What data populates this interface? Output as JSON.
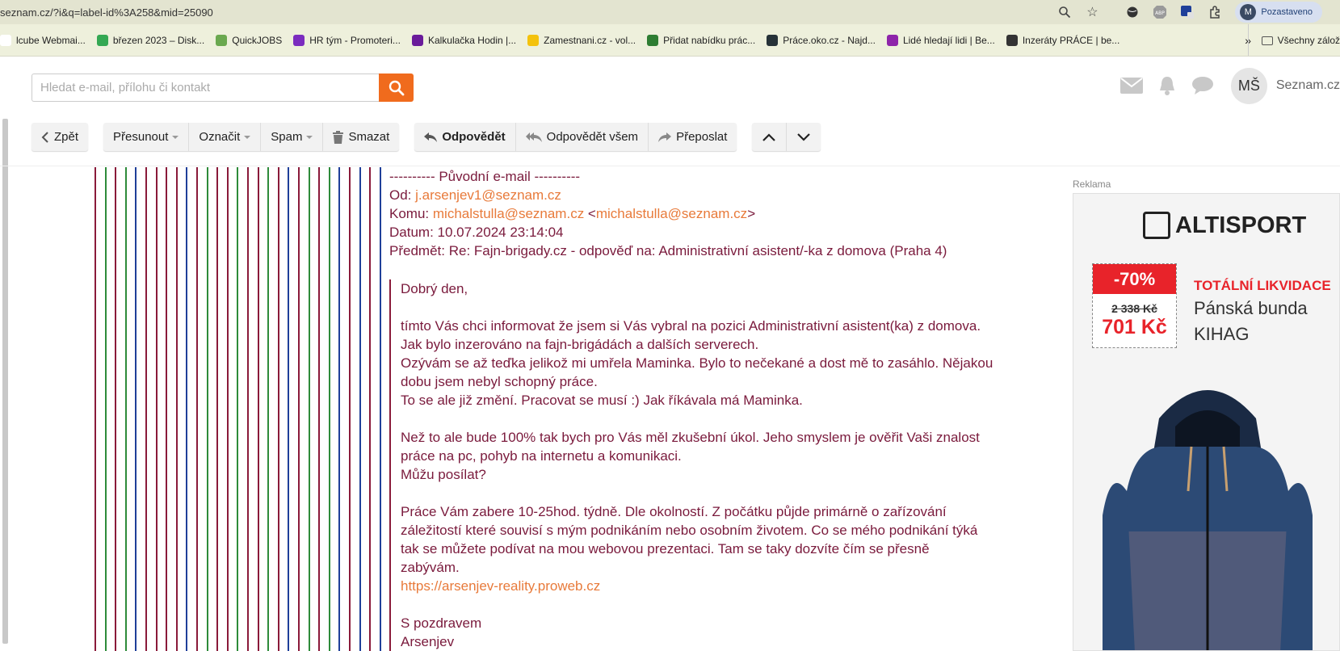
{
  "browser": {
    "url": "seznam.cz/?i&q=label-id%3A258&mid=25090",
    "profile_initial": "M",
    "profile_status": "Pozastaveno",
    "bookmarks": [
      {
        "label": "lcube Webmai...",
        "color": "#ffffff"
      },
      {
        "label": "březen 2023 – Disk...",
        "color": "#34a853"
      },
      {
        "label": "QuickJOBS",
        "color": "#6aa84f"
      },
      {
        "label": "HR tým - Promoteri...",
        "color": "#7b2cbf"
      },
      {
        "label": "Kalkulačka Hodin |...",
        "color": "#6a1b9a"
      },
      {
        "label": "Zamestnani.cz - vol...",
        "color": "#f4c20d"
      },
      {
        "label": "Přidat nabídku prác...",
        "color": "#2e7d32"
      },
      {
        "label": "Práce.oko.cz - Najd...",
        "color": "#263238"
      },
      {
        "label": "Lidé hledají lidi | Be...",
        "color": "#8e24aa"
      },
      {
        "label": "Inzeráty PRÁCE | be...",
        "color": "#333333"
      }
    ],
    "bookmarks_more": "»",
    "all_bookmarks": "Všechny zálož"
  },
  "search": {
    "placeholder": "Hledat e-mail, přílohu či kontakt"
  },
  "header": {
    "avatar_initials": "MŠ",
    "brand": "Seznam.cz"
  },
  "toolbar": {
    "back": "Zpět",
    "move": "Přesunout",
    "mark": "Označit",
    "spam": "Spam",
    "delete": "Smazat",
    "reply": "Odpovědět",
    "reply_all": "Odpovědět všem",
    "forward": "Přeposlat"
  },
  "message": {
    "original_header": "---------- Původní e-mail ----------",
    "from_label": "Od:",
    "from": "j.arsenjev1@seznam.cz",
    "to_label": "Komu:",
    "to_name": "michalstulla@seznam.cz",
    "to_email": "michalstulla@seznam.cz",
    "date_label": "Datum:",
    "date": "10.07.2024 23:14:04",
    "subject_label": "Předmět:",
    "subject": "Re: Fajn-brigady.cz - odpověď na: Administrativní asistent/-ka z domova (Praha 4)",
    "greeting": "Dobrý den,",
    "p1_l1": "tímto Vás chci informovat že jsem si Vás vybral na pozici Administrativní asistent(ka) z domova.",
    "p1_l2": "Jak bylo inzerováno na fajn-brigádách a dalších serverech.",
    "p1_l3": "Ozývám se až teďka jelikož mi umřela Maminka. Bylo to nečekané a dost mě to zasáhlo. Nějakou",
    "p1_l4": "dobu jsem nebyl schopný práce.",
    "p1_l5": "To se ale již změní. Pracovat se musí :) Jak říkávala má Maminka.",
    "p2_l1": "Než to ale bude 100% tak bych pro Vás měl zkušební úkol. Jeho smyslem je ověřit Vaši znalost",
    "p2_l2": "práce na pc, pohyb na internetu a komunikaci.",
    "p2_l3": "Můžu posílat?",
    "p3_l1": "Práce Vám zabere 10-25hod. týdně. Dle okolností. Z počátku půjde primárně o zařízování",
    "p3_l2": "záležitostí které souvisí s mým podnikáním nebo osobním životem. Co se mého podnikání týká",
    "p3_l3": "tak se můžete podívat na mou webovou prezentaci. Tam se taky dozvíte čím se přesně",
    "p3_l4": "zabývám.",
    "link": "https://arsenjev-reality.proweb.cz",
    "sign1": "S pozdravem",
    "sign2": "Arsenjev"
  },
  "quote_line_colors": [
    "#8a1a3a",
    "#2e8b3a",
    "#8a1a3a",
    "#2e8b3a",
    "#1f3f99",
    "#8a1a3a",
    "#8a1a3a",
    "#8a1a3a",
    "#8a1a3a",
    "#1f3f99",
    "#8a1a3a",
    "#2e8b3a",
    "#8a1a3a",
    "#8a1a3a",
    "#2e8b3a",
    "#8a1a3a",
    "#8a1a3a",
    "#2e8b3a",
    "#8a1a3a",
    "#1f3f99",
    "#8a1a3a",
    "#2e8b3a",
    "#8a1a3a",
    "#2e8b3a",
    "#1f3f99",
    "#8a1a3a",
    "#1f3f99",
    "#8a1a3a",
    "#1f3f99"
  ],
  "ad": {
    "label": "Reklama",
    "brand": "ALTISPORT",
    "discount": "-70%",
    "old_price": "2 338 Kč",
    "new_price": "701 Kč",
    "headline": "TOTÁLNÍ LIKVIDACE",
    "product_l1": "Pánská bunda",
    "product_l2": "KIHAG"
  },
  "colors": {
    "accent": "#f06b1d",
    "quote": "#7a1a3c",
    "link": "#e87a3a"
  }
}
